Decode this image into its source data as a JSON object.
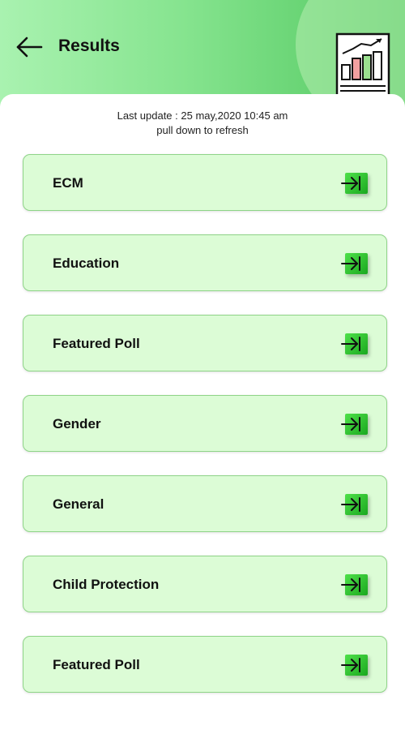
{
  "header": {
    "title": "Results",
    "back_icon": "arrow-left-icon",
    "report_icon": "bar-chart-report-icon"
  },
  "status": {
    "last_update": "Last update : 25 may,2020 10:45 am",
    "refresh_hint": "pull down to refresh"
  },
  "categories": [
    {
      "label": "ECM",
      "icon": "arrow-right-into-box-icon"
    },
    {
      "label": "Education",
      "icon": "arrow-right-into-box-icon"
    },
    {
      "label": "Featured Poll",
      "icon": "arrow-right-into-box-icon"
    },
    {
      "label": "Gender",
      "icon": "arrow-right-into-box-icon"
    },
    {
      "label": "General",
      "icon": "arrow-right-into-box-icon"
    },
    {
      "label": "Child Protection",
      "icon": "arrow-right-into-box-icon"
    },
    {
      "label": "Featured Poll",
      "icon": "arrow-right-into-box-icon"
    }
  ],
  "colors": {
    "header_gradient_start": "#a9f2b0",
    "header_gradient_end": "#52c860",
    "card_background": "#dcfcd6",
    "card_border": "#8fd488",
    "go_button": "#2ec22f"
  }
}
